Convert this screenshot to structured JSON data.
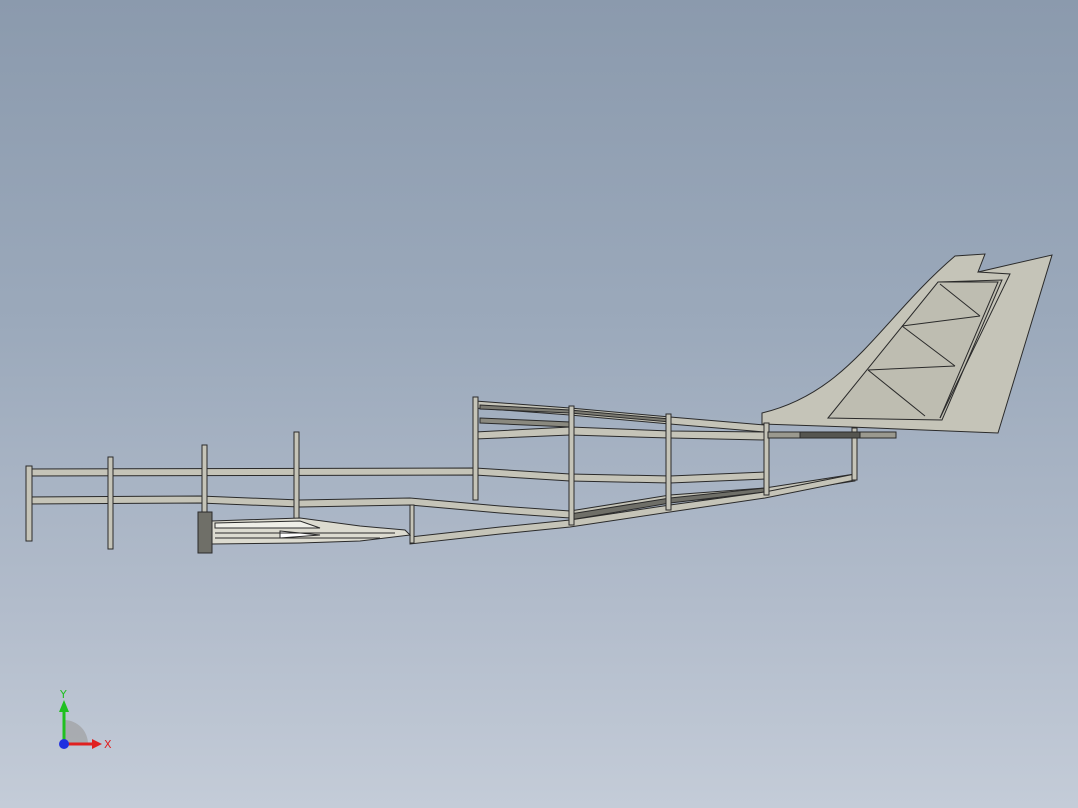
{
  "viewport": {
    "background_top": "#8b9aad",
    "background_bottom": "#c4ccd8"
  },
  "model": {
    "part_fill": "#c5c4b8",
    "part_fill_light": "#dcdbd0",
    "edge_color": "#2a2a2a",
    "dark_part": "#6f6f68"
  },
  "triad": {
    "x_label": "X",
    "y_label": "Y",
    "x_color": "#e02020",
    "y_color": "#20c020",
    "z_color": "#2030e0"
  }
}
